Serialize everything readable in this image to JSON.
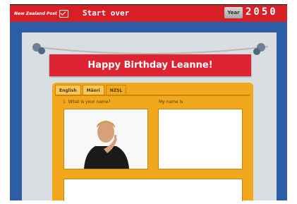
{
  "header": {
    "brand": "New Zealand Post",
    "start_over": "Start over",
    "year_label": "Year",
    "year_value": "2050"
  },
  "banner": {
    "title": "Happy Birthday Leanne!"
  },
  "tabs": [
    {
      "label": "English",
      "active": false
    },
    {
      "label": "Māori",
      "active": false
    },
    {
      "label": "NZSL",
      "active": true
    }
  ],
  "form": {
    "question_number": "1.",
    "question": "What is your name?",
    "answer_label": "My name is"
  },
  "colors": {
    "brand_red": "#d81f26",
    "banner_red": "#de2332",
    "card_orange": "#f2a81c",
    "stage_blue": "#2c5ea8"
  },
  "icons": [
    "envelope-icon",
    "rope-knot-icon"
  ]
}
